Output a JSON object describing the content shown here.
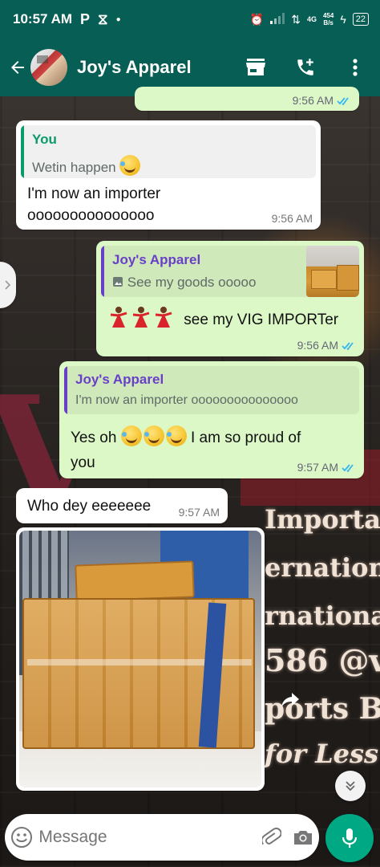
{
  "status_bar": {
    "time": "10:57 AM",
    "notif_icons": [
      "parking-app-icon",
      "hourglass-icon",
      "dot-icon"
    ],
    "net_speed_value": "454",
    "net_speed_unit": "B/s",
    "network": "4G",
    "battery": "22"
  },
  "header": {
    "contact_name": "Joy's Apparel",
    "avatar": "contact-avatar",
    "actions": [
      "store-icon",
      "add-call-icon",
      "more-vert-icon"
    ]
  },
  "messages": [
    {
      "id": "m0",
      "direction": "out",
      "time": "9:56 AM",
      "ticks": "read"
    },
    {
      "id": "m1",
      "direction": "in",
      "quote": {
        "author": "You",
        "text": "Wetin happen"
      },
      "text_line1": "I'm now an importer",
      "text_line2": "ooooooooooooooo",
      "time": "9:56 AM"
    },
    {
      "id": "m2",
      "direction": "out",
      "quote": {
        "author": "Joy's Apparel",
        "text": "See my goods ooooo"
      },
      "text": "see my VIG IMPORTer",
      "time": "9:56 AM",
      "ticks": "read"
    },
    {
      "id": "m3",
      "direction": "out",
      "quote": {
        "author": "Joy's Apparel",
        "text": "I'm now an importer ooooooooooooooo"
      },
      "text_line1": "Yes oh",
      "text_line1b": "I am so proud of",
      "text_line2": "you",
      "time": "9:57 AM",
      "ticks": "read"
    },
    {
      "id": "m4",
      "direction": "in",
      "text": "Who dey eeeeeee",
      "time": "9:57 AM"
    },
    {
      "id": "m5",
      "direction": "in",
      "type": "image",
      "image": "photo-of-packed-cartons"
    }
  ],
  "input": {
    "placeholder": "Message"
  },
  "colors": {
    "header_bg": "#075e54",
    "outgoing_bubble": "#dcf8c6",
    "incoming_bubble": "#ffffff",
    "you_author": "#0b9a6b",
    "contact_author": "#6a3fc7",
    "read_ticks": "#34b7f1",
    "mic_button": "#00a884"
  }
}
